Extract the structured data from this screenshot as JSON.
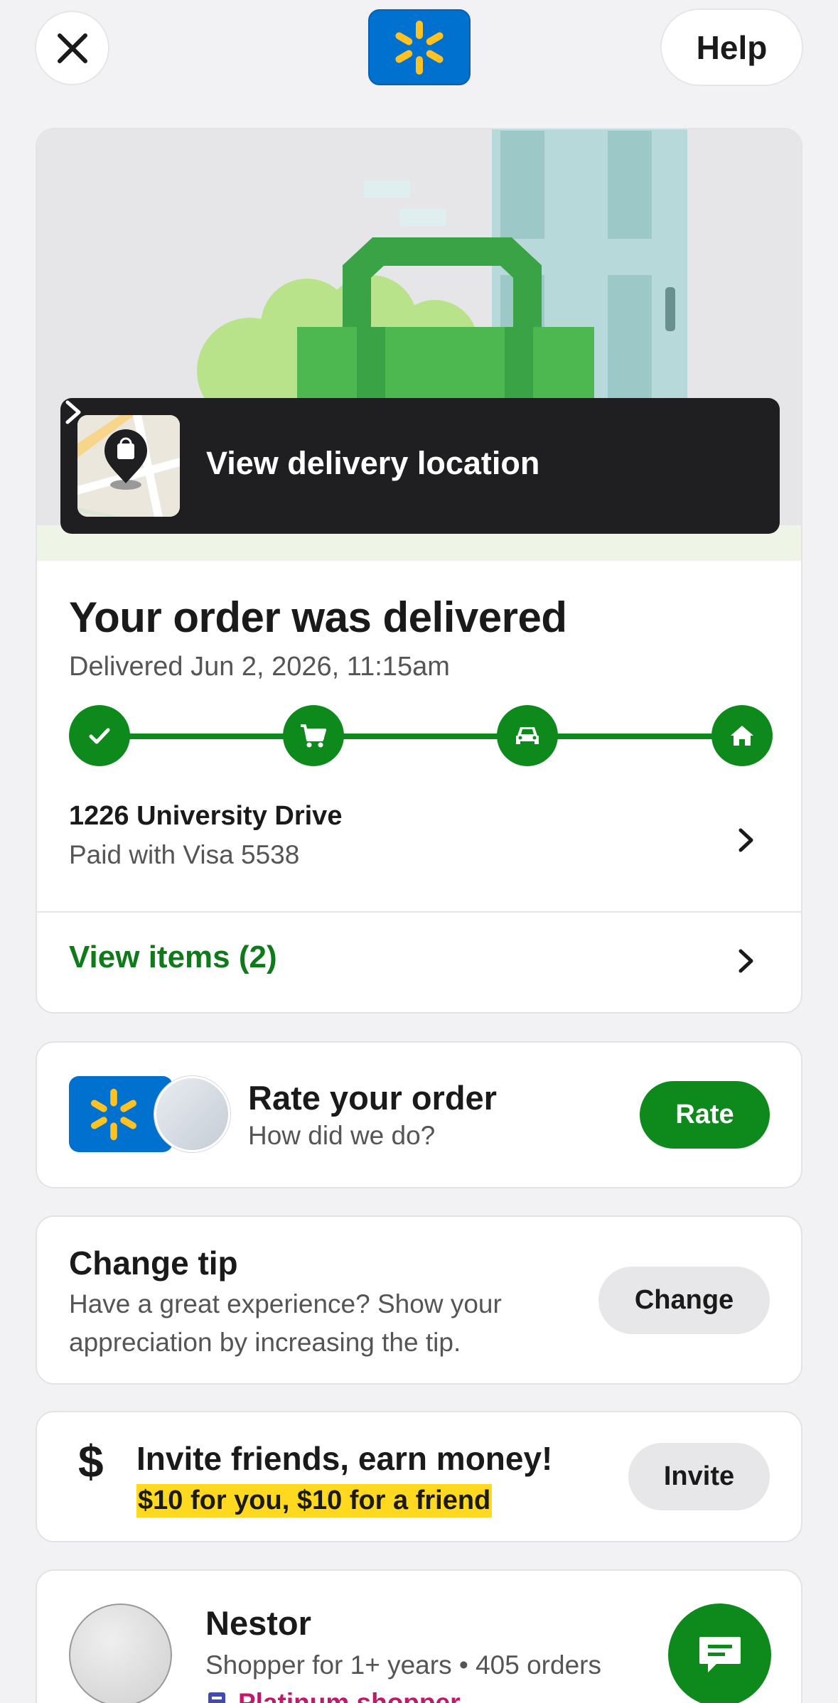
{
  "header": {
    "help_label": "Help",
    "close_icon": "close-icon",
    "logo": "walmart-spark-logo"
  },
  "hero": {
    "location_button_label": "View delivery location"
  },
  "order": {
    "title": "Your order was delivered",
    "delivered_at": "Delivered Jun 2, 2026, 11:15am",
    "steps": [
      "check-icon",
      "cart-icon",
      "car-icon",
      "home-icon"
    ],
    "address": "1226 University Drive",
    "payment": "Paid with Visa 5538",
    "view_items_label": "View items (2)"
  },
  "rate": {
    "title": "Rate your order",
    "subtitle": "How did we do?",
    "button_label": "Rate"
  },
  "tip": {
    "title": "Change tip",
    "text": "Have a great experience? Show your appreciation by increasing the tip.",
    "button_label": "Change"
  },
  "invite": {
    "icon": "$",
    "title": "Invite friends, earn money!",
    "promo": "$10 for you, $10 for a friend",
    "button_label": "Invite"
  },
  "shopper": {
    "name": "Nestor",
    "meta": "Shopper for 1+ years • 405 orders",
    "badge": "Platinum shopper"
  },
  "colors": {
    "brand_blue": "#0071ce",
    "spark_yellow": "#ffc220",
    "success_green": "#0e8a1d",
    "promo_highlight": "#ffd91f",
    "badge_pink": "#c4166b"
  }
}
